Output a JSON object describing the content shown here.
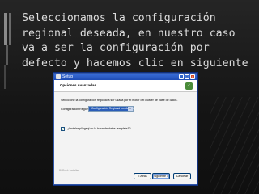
{
  "slide": {
    "caption_lines": [
      "Seleccionamos la configuración",
      "regional deseada, en nuestro caso",
      "va a ser la configuración por",
      "defecto y hacemos clic en siguiente"
    ]
  },
  "window": {
    "title": "Setup",
    "header_title": "Opciones Avanzadas",
    "description": "Seleccione la configuración regional a ser usada por el motor del cluster de base de datos.",
    "region_label": "Configuración Regional",
    "region_value": "[Configuración Regional por defecto]",
    "checkbox_label": "¿Instalar pl/pgsql en la base de datos template1?",
    "footer_brand": "BitRock Installer",
    "buttons": {
      "back": "< Atrás",
      "next": "Siguiente >",
      "cancel": "Cancelar"
    }
  }
}
